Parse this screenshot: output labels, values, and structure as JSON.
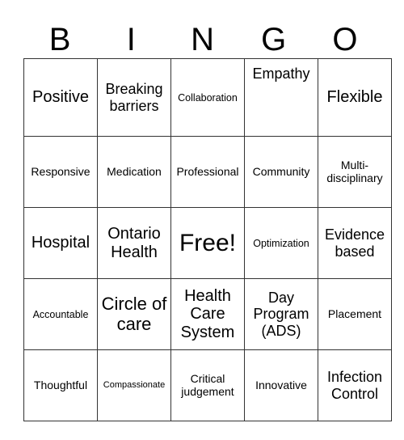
{
  "title_letters": [
    "B",
    "I",
    "N",
    "G",
    "O"
  ],
  "rows": [
    [
      "Positive",
      "Breaking barriers",
      "Collaboration",
      "Empathy",
      "Flexible"
    ],
    [
      "Responsive",
      "Medication",
      "Professional",
      "Community",
      "Multi-disciplinary"
    ],
    [
      "Hospital",
      "Ontario Health",
      "Free!",
      "Optimization",
      "Evidence based"
    ],
    [
      "Accountable",
      "Circle of care",
      "Health Care System",
      "Day Program (ADS)",
      "Placement"
    ],
    [
      "Thoughtful",
      "Compassionate",
      "Critical judgement",
      "Innovative",
      "Infection Control"
    ]
  ]
}
